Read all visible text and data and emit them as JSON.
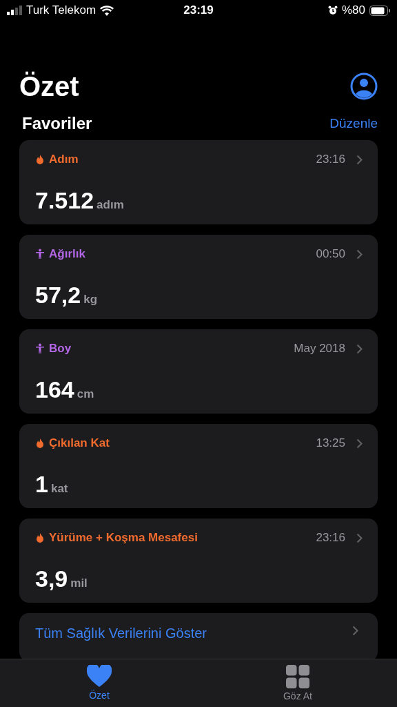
{
  "status_bar": {
    "carrier": "Turk Telekom",
    "time": "23:19",
    "battery": "%80"
  },
  "title": "Özet",
  "favorites": {
    "heading": "Favoriler",
    "edit": "Düzenle"
  },
  "cards": [
    {
      "kind": "activity",
      "label": "Adım",
      "time": "23:16",
      "value": "7.512",
      "unit": "adım"
    },
    {
      "kind": "body",
      "label": "Ağırlık",
      "time": "00:50",
      "value": "57,2",
      "unit": "kg"
    },
    {
      "kind": "body",
      "label": "Boy",
      "time": "May 2018",
      "value": "164",
      "unit": "cm"
    },
    {
      "kind": "activity",
      "label": "Çıkılan Kat",
      "time": "13:25",
      "value": "1",
      "unit": "kat"
    },
    {
      "kind": "activity",
      "label": "Yürüme + Koşma Mesafesi",
      "time": "23:16",
      "value": "3,9",
      "unit": "mil"
    }
  ],
  "show_all": "Tüm Sağlık Verilerini Göster",
  "tabs": [
    {
      "label": "Özet",
      "kind": "heart",
      "selected": true
    },
    {
      "label": "Göz At",
      "kind": "grid",
      "selected": false
    }
  ]
}
